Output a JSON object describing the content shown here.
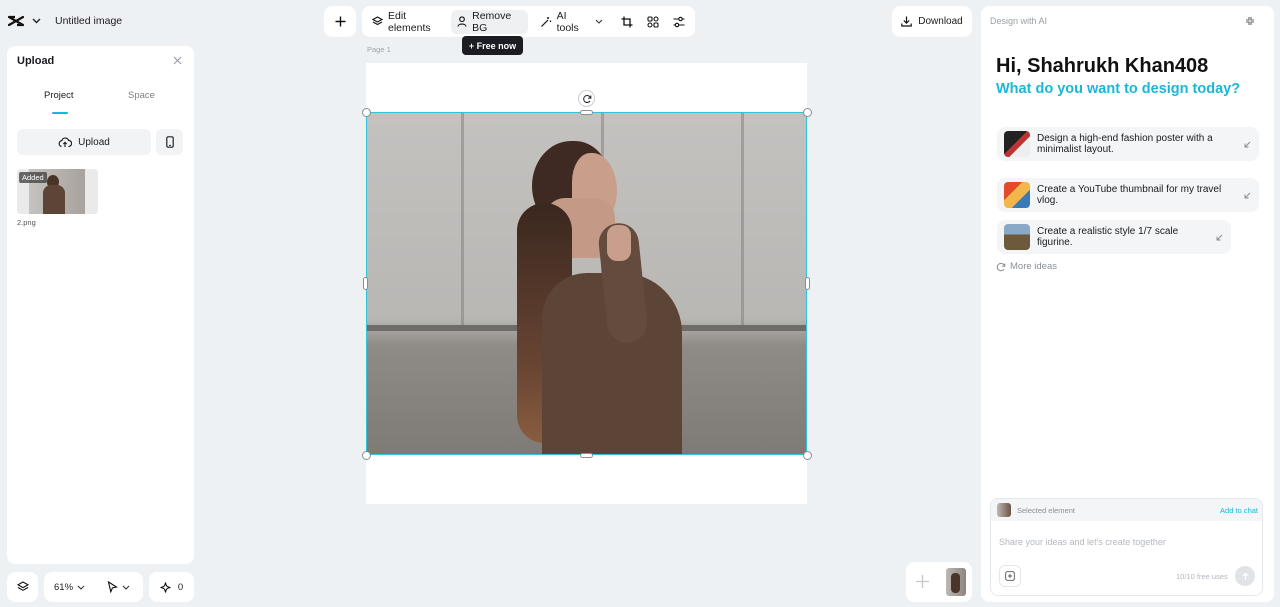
{
  "app": {
    "title": "Untitled image"
  },
  "toolbar": {
    "edit_elements": "Edit elements",
    "remove_bg": "Remove BG",
    "ai_tools": "AI tools",
    "tooltip": "+ Free now",
    "download": "Download"
  },
  "left_panel": {
    "title": "Upload",
    "tabs": [
      {
        "label": "Project",
        "active": true
      },
      {
        "label": "Space",
        "active": false
      }
    ],
    "upload_button": "Upload",
    "file": {
      "badge": "Added",
      "name": "2.png"
    }
  },
  "canvas": {
    "page_label": "Page 1"
  },
  "bottom_bar": {
    "zoom": "61%",
    "count": "0"
  },
  "ai_panel": {
    "header": "Design with AI",
    "greeting": "Hi, Shahrukh Khan408",
    "subtitle": "What do you want to design today?",
    "suggestions": [
      {
        "text": "Design a high-end fashion poster with a minimalist layout."
      },
      {
        "text": "Create a YouTube thumbnail for my travel vlog."
      },
      {
        "text": "Create a realistic style 1/7 scale figurine."
      }
    ],
    "more_ideas": "More ideas",
    "selected_element": "Selected element",
    "add_to_chat": "Add to chat",
    "input_placeholder": "Share your ideas and let's create together",
    "free_uses": "10/10 free uses"
  },
  "colors": {
    "accent": "#1bb7d6",
    "selection": "#33c3d9",
    "tooltip_bg": "#1b1d22"
  }
}
